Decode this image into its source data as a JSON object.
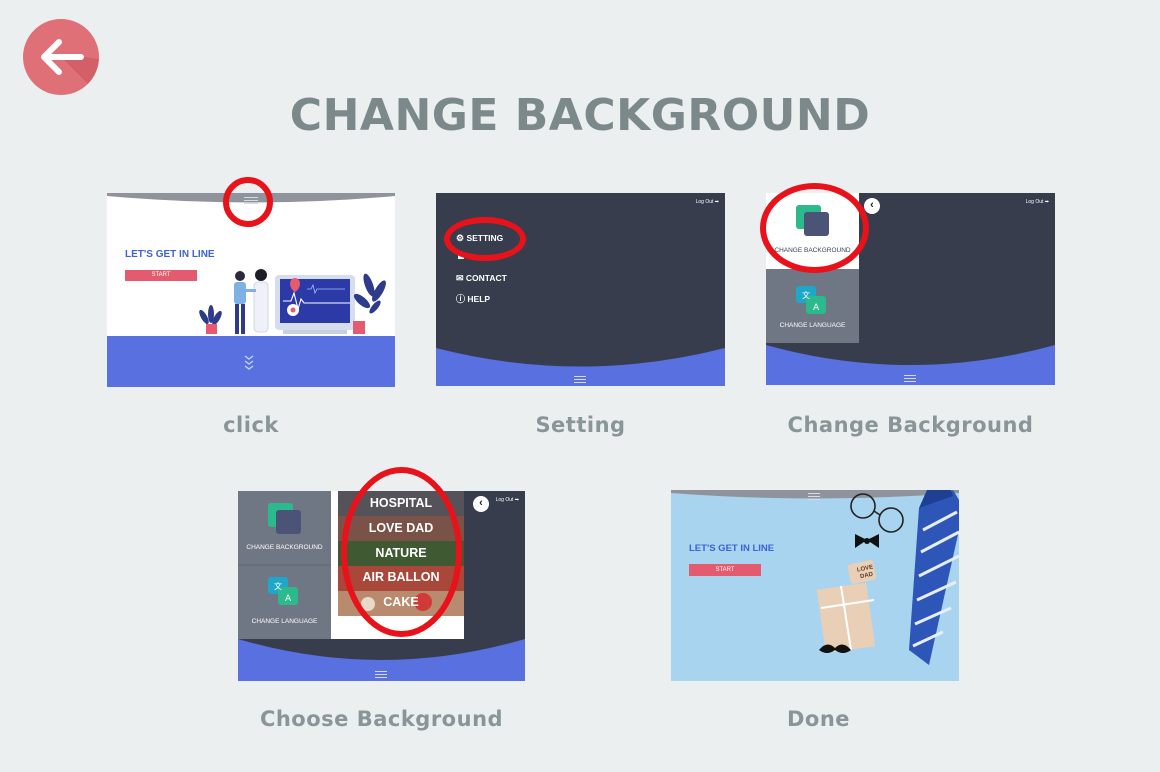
{
  "page": {
    "title": "CHANGE BACKGROUND",
    "accent": "#e07078",
    "title_color": "#7c898b"
  },
  "back_button": {
    "icon": "arrow-left-icon"
  },
  "steps": [
    {
      "caption": "click",
      "screen": {
        "heading": "LET'S GET IN LINE",
        "start": "START",
        "icon": "menu-icon"
      }
    },
    {
      "caption": "Setting",
      "screen": {
        "logout": "Log Out",
        "menu": [
          "SETTING",
          "CONTACT",
          "HELP"
        ]
      }
    },
    {
      "caption": "Change Background",
      "screen": {
        "logout": "Log Out",
        "tiles": [
          "CHANGE BACKGROUND",
          "CHANGE LANGUAGE"
        ]
      }
    },
    {
      "caption": "Choose Background",
      "screen": {
        "logout": "Log Out",
        "tiles": [
          "CHANGE BACKGROUND",
          "CHANGE LANGUAGE"
        ],
        "backgrounds": [
          "HOSPITAL",
          "LOVE DAD",
          "NATURE",
          "AIR BALLON",
          "CAKE"
        ]
      }
    },
    {
      "caption": "Done",
      "screen": {
        "heading": "LET'S GET IN LINE",
        "start": "START",
        "tag": "LOVE DAD"
      }
    }
  ]
}
